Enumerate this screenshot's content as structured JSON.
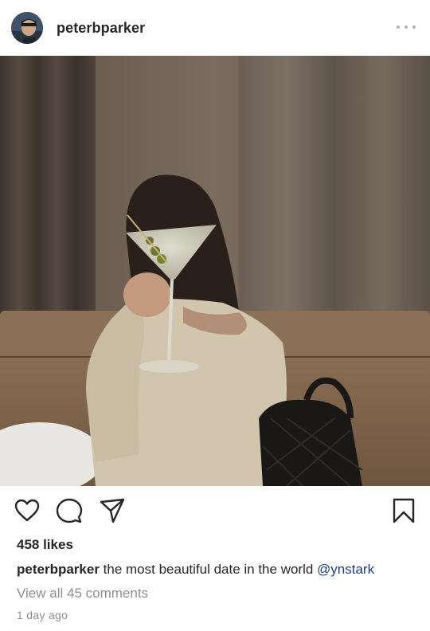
{
  "post": {
    "username": "peterbparker",
    "avatar_icon": "profile-avatar",
    "more_icon": "more-options-icon",
    "image_alt": "Woman holding a martini glass in front of her face",
    "likes": "458 likes",
    "caption": {
      "username": "peterbparker",
      "text": " the most beautiful date in the world ",
      "mention": "@ynstark"
    },
    "comments_link": "View all 45 comments",
    "timestamp": "1 day ago"
  },
  "actions": {
    "like_icon": "heart-icon",
    "comment_icon": "comment-icon",
    "share_icon": "share-icon",
    "save_icon": "bookmark-icon"
  },
  "colors": {
    "text": "#262626",
    "muted": "#8e8e8e",
    "mention": "#1e3f7a"
  }
}
